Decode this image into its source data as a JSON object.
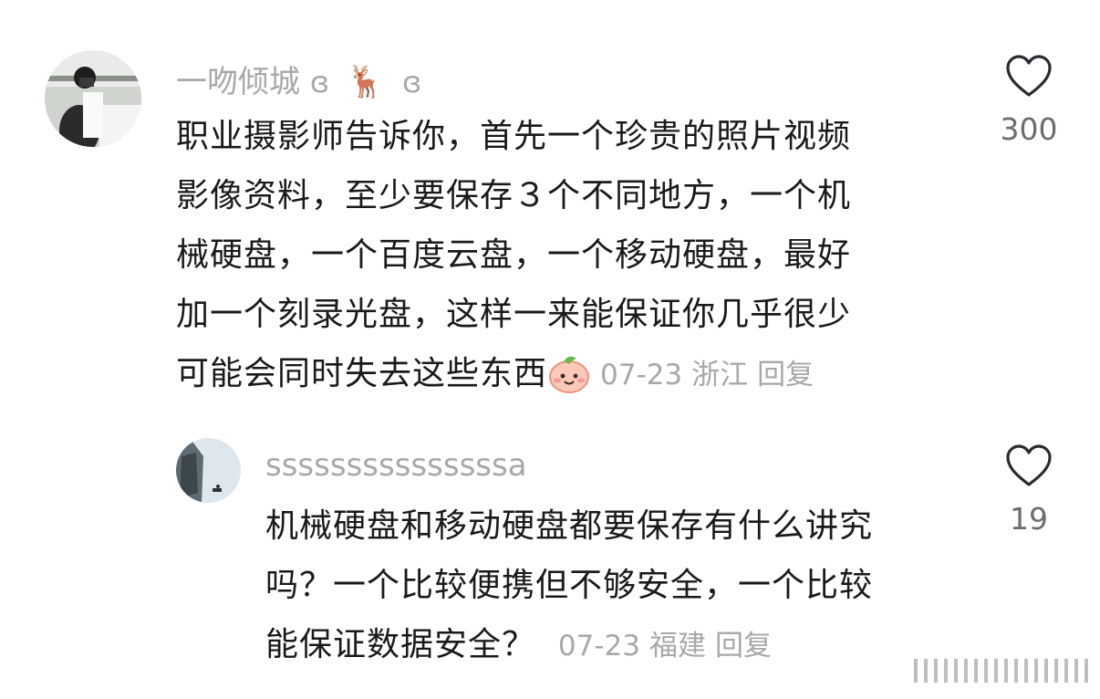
{
  "comments": [
    {
      "username": "一吻倾城",
      "username_suffix_left": "ɞ",
      "username_emoji": "🦌",
      "username_suffix_right": "ɞ",
      "lines": [
        "职业摄影师告诉你，首先一个珍贵的照片视频",
        "影像资料，至少要保存３个不同地方，一个机",
        "械硬盘，一个百度云盘，一个移动硬盘，最好",
        "加一个刻录光盘，这样一来能保证你几乎很少",
        "可能会同时失去这些东西"
      ],
      "date": "07-23",
      "location": "浙江",
      "reply_label": "回复",
      "like_count": "300",
      "icons": [
        "avatar-photo",
        "heart-icon",
        "peach-face-emoji"
      ]
    },
    {
      "username": "sssssssssssssssa",
      "lines": [
        "机械硬盘和移动硬盘都要保存有什么讲究",
        "吗？一个比较便携但不够安全，一个比较",
        "能保证数据安全？"
      ],
      "date": "07-23",
      "location": "福建",
      "reply_label": "回复",
      "like_count": "19",
      "icons": [
        "avatar-photo",
        "heart-icon"
      ]
    }
  ],
  "colors": {
    "text": "#1a1a1a",
    "muted": "#a8a8ac",
    "like_count": "#6b6b70"
  }
}
